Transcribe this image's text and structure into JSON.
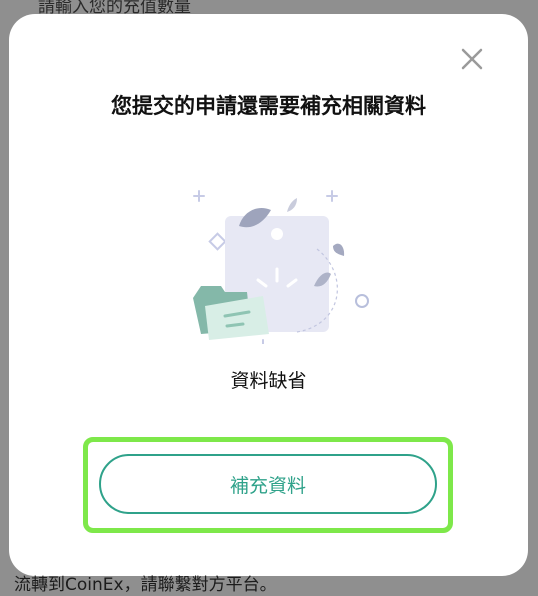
{
  "background": {
    "top_text": "請輸入您的充值數量",
    "bottom_text": "流轉到CoinEx，請聯繫對方平台。"
  },
  "modal": {
    "title": "您提交的申請還需要補充相關資料",
    "illustration": "missing-documents-illustration",
    "caption": "資料缺省",
    "primary_button_label": "補充資料",
    "close_icon": "close-icon"
  },
  "colors": {
    "accent": "#2fa28a",
    "highlight": "#7ee84a"
  }
}
